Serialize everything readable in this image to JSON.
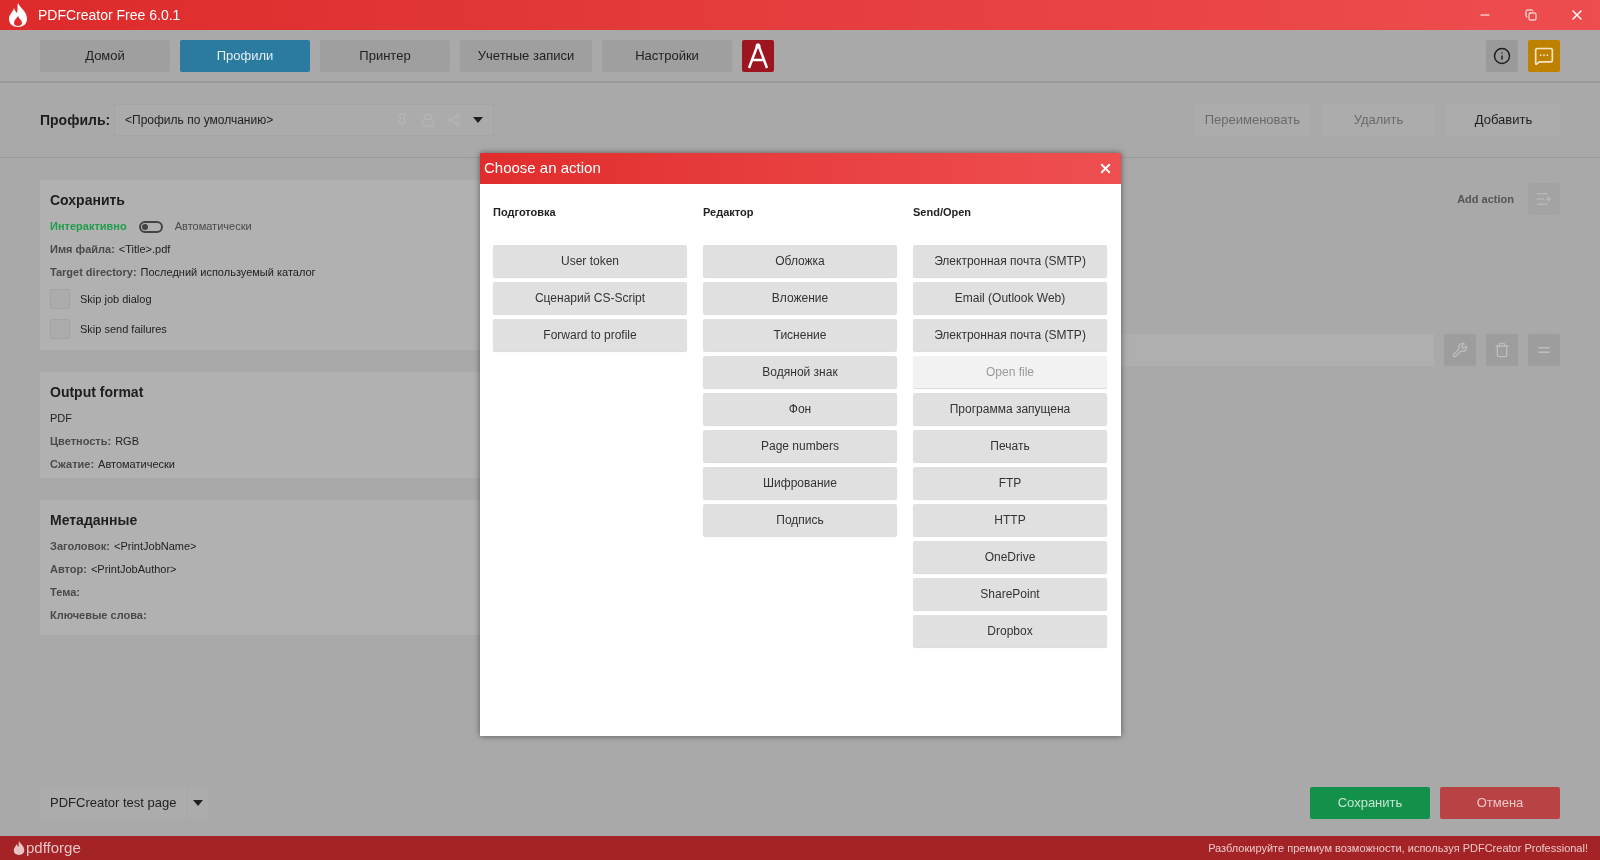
{
  "window": {
    "title": "PDFCreator Free 6.0.1"
  },
  "nav": {
    "tabs": [
      {
        "label": "Домой",
        "selected": false
      },
      {
        "label": "Профили",
        "selected": true
      },
      {
        "label": "Принтер",
        "selected": false
      },
      {
        "label": "Учетные записи",
        "selected": false
      },
      {
        "label": "Настройки",
        "selected": false
      }
    ]
  },
  "profile": {
    "label": "Профиль:",
    "value": "<Профиль по умолчанию>"
  },
  "profile_buttons": [
    {
      "label": "Переименовать",
      "disabled": true
    },
    {
      "label": "Удалить",
      "disabled": true
    },
    {
      "label": "Добавить",
      "disabled": false
    }
  ],
  "save_panel": {
    "title": "Сохранить",
    "mode_left": "Интерактивно",
    "mode_right": "Автоматически",
    "automatic": false,
    "fields": [
      {
        "label": "Имя файла:",
        "value": "<Title>.pdf"
      },
      {
        "label": "Target directory:",
        "value": "Последний используемый каталог"
      }
    ],
    "checkboxes": [
      {
        "label": "Skip job dialog",
        "checked": false
      },
      {
        "label": "Skip send failures",
        "checked": false
      }
    ]
  },
  "output_panel": {
    "title": "Output format",
    "format": "PDF",
    "fields": [
      {
        "label": "Цветность:",
        "value": "RGB"
      },
      {
        "label": "Сжатие:",
        "value": "Автоматически"
      }
    ]
  },
  "metadata_panel": {
    "title": "Метаданные",
    "fields": [
      {
        "label": "Заголовок:",
        "value": "<PrintJobName>"
      },
      {
        "label": "Автор:",
        "value": "<PrintJobAuthor>"
      },
      {
        "label": "Тема:"
      },
      {
        "label": "Ключевые слова:"
      }
    ]
  },
  "actions": {
    "add_label": "Add action"
  },
  "test_page": {
    "label": "PDFCreator test page"
  },
  "footer_buttons": [
    {
      "label": "Сохранить",
      "kind": "primary"
    },
    {
      "label": "Отмена",
      "kind": "cancel"
    }
  ],
  "status_bar": {
    "brand": "pdfforge",
    "promo": "Разблокируйте премиум возможности, используя PDFCreator Professional!"
  },
  "dialog": {
    "title": "Choose an action",
    "columns": [
      {
        "heading": "Подготовка",
        "items": [
          {
            "label": "User token",
            "disabled": false
          },
          {
            "label": "Сценарий CS-Script",
            "disabled": false
          },
          {
            "label": "Forward to profile",
            "disabled": false
          }
        ]
      },
      {
        "heading": "Редактор",
        "items": [
          {
            "label": "Обложка",
            "disabled": false
          },
          {
            "label": "Вложение",
            "disabled": false
          },
          {
            "label": "Тиснение",
            "disabled": false
          },
          {
            "label": "Водяной знак",
            "disabled": false
          },
          {
            "label": "Фон",
            "disabled": false
          },
          {
            "label": "Page numbers",
            "disabled": false
          },
          {
            "label": "Шифрование",
            "disabled": false
          },
          {
            "label": "Подпись",
            "disabled": false
          }
        ]
      },
      {
        "heading": "Send/Open",
        "items": [
          {
            "label": "Электронная почта (SMTP)",
            "disabled": false
          },
          {
            "label": "Email (Outlook Web)",
            "disabled": false
          },
          {
            "label": "Электронная почта (SMTP)",
            "disabled": false
          },
          {
            "label": "Open file",
            "disabled": true
          },
          {
            "label": "Программа запущена",
            "disabled": false
          },
          {
            "label": "Печать",
            "disabled": false
          },
          {
            "label": "FTP",
            "disabled": false
          },
          {
            "label": "HTTP",
            "disabled": false
          },
          {
            "label": "OneDrive",
            "disabled": false
          },
          {
            "label": "SharePoint",
            "disabled": false
          },
          {
            "label": "Dropbox",
            "disabled": false
          }
        ]
      }
    ]
  }
}
